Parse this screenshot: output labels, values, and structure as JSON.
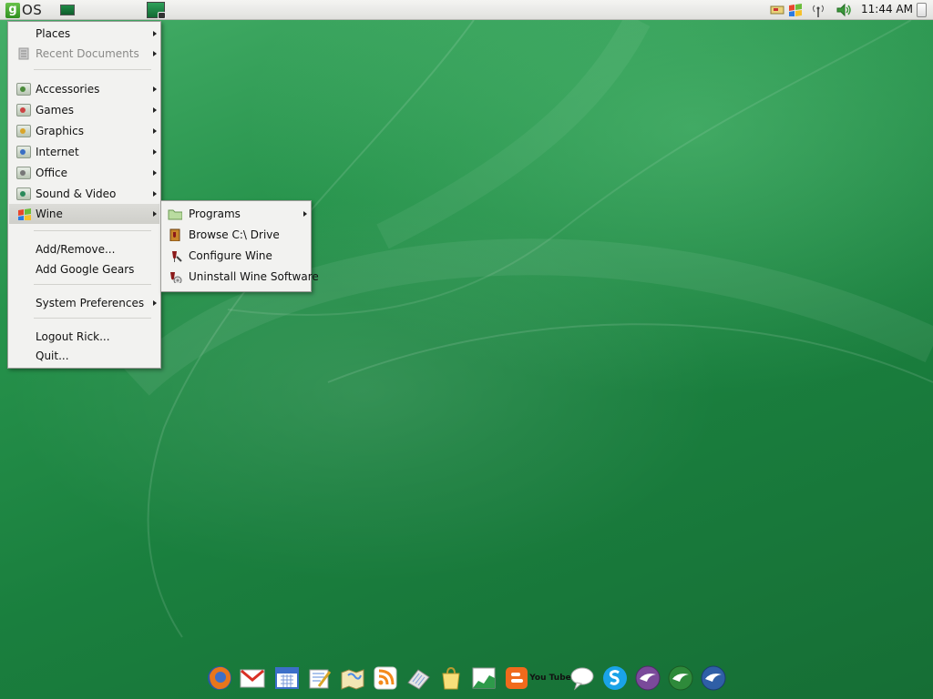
{
  "top_panel": {
    "logo_letter": "g",
    "logo_text": "OS",
    "clock": "11:44 AM",
    "tray_icons": [
      "network-card-icon",
      "windows-flag-icon",
      "wireless-icon",
      "volume-icon",
      "battery-icon"
    ]
  },
  "main_menu": {
    "items": [
      {
        "label": "Places",
        "has_submenu": true
      },
      {
        "label": "Recent Documents",
        "has_submenu": true,
        "disabled": true
      },
      {
        "label": "Accessories",
        "has_submenu": true
      },
      {
        "label": "Games",
        "has_submenu": true
      },
      {
        "label": "Graphics",
        "has_submenu": true
      },
      {
        "label": "Internet",
        "has_submenu": true
      },
      {
        "label": "Office",
        "has_submenu": true
      },
      {
        "label": "Sound & Video",
        "has_submenu": true
      },
      {
        "label": "Wine",
        "has_submenu": true,
        "active": true
      },
      {
        "label": "Add/Remove...",
        "has_submenu": false
      },
      {
        "label": "Add Google Gears",
        "has_submenu": false
      },
      {
        "label": "System Preferences",
        "has_submenu": true
      },
      {
        "label": "Logout Rick...",
        "has_submenu": false
      },
      {
        "label": "Quit...",
        "has_submenu": false
      }
    ]
  },
  "wine_submenu": {
    "items": [
      {
        "label": "Programs",
        "icon": "folder-icon",
        "has_submenu": true
      },
      {
        "label": "Browse C:\\ Drive",
        "icon": "wine-browse-icon",
        "has_submenu": false
      },
      {
        "label": "Configure Wine",
        "icon": "wine-config-icon",
        "has_submenu": false
      },
      {
        "label": "Uninstall Wine Software",
        "icon": "wine-uninstall-icon",
        "has_submenu": false
      }
    ]
  },
  "dock": {
    "icons": [
      "firefox-icon",
      "gmail-icon",
      "calendar-icon",
      "document-editor-icon",
      "maps-icon",
      "rss-feed-icon",
      "news-icon",
      "shopping-bag-icon",
      "spreadsheet-icon",
      "blogger-icon",
      "youtube-icon",
      "chat-icon",
      "skype-icon",
      "openoffice-writer-icon",
      "openoffice-calc-icon",
      "openoffice-impress-icon"
    ],
    "youtube_text": "You Tube"
  },
  "colors": {
    "desktop_green": "#1e8a45",
    "menu_background": "#f2f2f0",
    "menu_active": "#d4d4d0"
  }
}
